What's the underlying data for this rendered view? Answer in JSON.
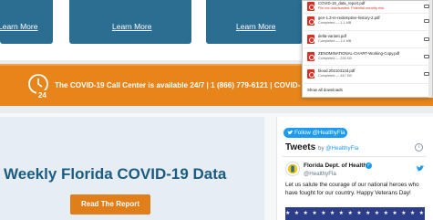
{
  "cards": {
    "links": [
      "Learn More",
      "Learn More",
      "Learn More"
    ]
  },
  "callcenter": {
    "text": "The COVID-19 Call Center is available 24/7 | 1 (866) 779-6121 | COVID-",
    "clock_label": "24"
  },
  "covid": {
    "title": "Weekly Florida COVID-19 Data",
    "button_label": "Read The Report"
  },
  "twitter": {
    "follow_label": "Follow @HealthyFla",
    "tweets_title": "Tweets",
    "tweets_by_prefix": "by",
    "tweets_by_handle": "@HealthyFla",
    "info_glyph": "i",
    "org_name": "Florida Dept. of Health",
    "verified_glyph": "✓",
    "handle": "@HealthyFla",
    "tweet_text": "Let us salute the courage of our national heroes who have fought for our country. Happy Veterans Day!",
    "flag_stars": "★★★★★★★★★★★★★★★★"
  },
  "downloads": {
    "items": [
      {
        "name": "COVID-19_data_report.pdf",
        "status": "File not downloaded. Potential security risk.",
        "status_type": "warn"
      },
      {
        "name": "gen-1.3-re-redemptive-history-2.pdf",
        "status": "Completed — 1.1 MB",
        "status_type": "ok"
      },
      {
        "name": "delta-variant.pdf",
        "status": "Completed — 1.4 MB",
        "status_type": "ok"
      },
      {
        "name": "ZENOMINATIONAL-CHART-Working-Copy.pdf",
        "status": "Completed — 226 KB",
        "status_type": "ok"
      },
      {
        "name": "blood.20210412d.pdf",
        "status": "Completed — 447 KB",
        "status_type": "ok"
      }
    ],
    "show_all": "Show all downloads"
  },
  "colors": {
    "card_blue": "#2c6d92",
    "callcenter_orange": "#e8851a",
    "title_blue": "#1c5c82",
    "button_orange": "#e07e1a",
    "twitter_blue": "#1d9bf0",
    "pdf_red": "#d93025"
  },
  "icons": [
    "clock-24-icon",
    "twitter-bird-icon",
    "info-icon",
    "verified-icon",
    "pdf-icon",
    "folder-icon"
  ]
}
